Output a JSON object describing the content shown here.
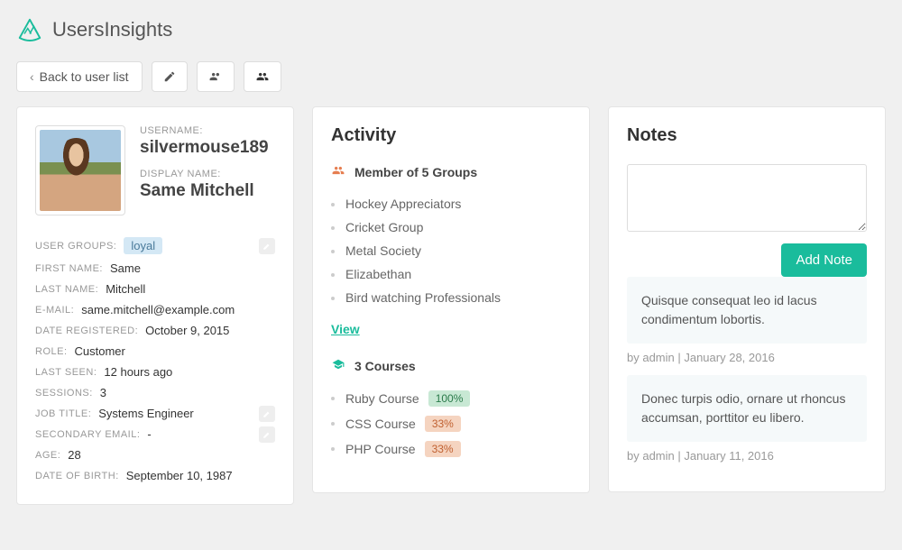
{
  "brand": {
    "name": "UsersInsights"
  },
  "toolbar": {
    "back_label": "Back to user list"
  },
  "profile": {
    "username_label": "USERNAME:",
    "username": "silvermouse189",
    "displayname_label": "DISPLAY NAME:",
    "displayname": "Same Mitchell",
    "fields": {
      "user_groups_label": "USER GROUPS:",
      "user_groups_value": "loyal",
      "first_name_label": "FIRST NAME:",
      "first_name_value": "Same",
      "last_name_label": "LAST NAME:",
      "last_name_value": "Mitchell",
      "email_label": "E-MAIL:",
      "email_value": "same.mitchell@example.com",
      "date_registered_label": "DATE REGISTERED:",
      "date_registered_value": "October 9, 2015",
      "role_label": "ROLE:",
      "role_value": "Customer",
      "last_seen_label": "LAST SEEN:",
      "last_seen_value": "12 hours ago",
      "sessions_label": "SESSIONS:",
      "sessions_value": "3",
      "job_title_label": "JOB TITLE:",
      "job_title_value": "Systems Engineer",
      "secondary_email_label": "SECONDARY EMAIL:",
      "secondary_email_value": "-",
      "age_label": "AGE:",
      "age_value": "28",
      "dob_label": "DATE OF BIRTH:",
      "dob_value": "September 10, 1987"
    }
  },
  "activity": {
    "title": "Activity",
    "groups_heading": "Member of 5 Groups",
    "groups": [
      "Hockey Appreciators",
      "Cricket Group",
      "Metal Society",
      "Elizabethan",
      "Bird watching Professionals"
    ],
    "view_label": "View",
    "courses_heading": "3 Courses",
    "courses": [
      {
        "name": "Ruby Course",
        "pct": "100%",
        "cls": "green"
      },
      {
        "name": "CSS Course",
        "pct": "33%",
        "cls": "orange"
      },
      {
        "name": "PHP Course",
        "pct": "33%",
        "cls": "orange"
      }
    ]
  },
  "notes": {
    "title": "Notes",
    "add_label": "Add Note",
    "items": [
      {
        "text": "Quisque consequat leo id lacus condimentum lobortis.",
        "meta": "by admin | January 28, 2016"
      },
      {
        "text": "Donec turpis odio, ornare ut rhoncus accumsan, porttitor eu libero.",
        "meta": "by admin | January 11, 2016"
      }
    ]
  }
}
